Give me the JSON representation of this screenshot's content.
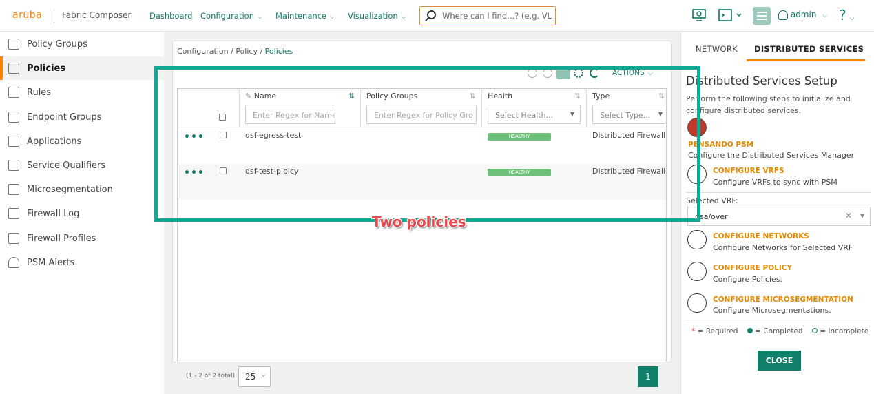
{
  "header": {
    "brand": "aruba",
    "app_name": "Fabric Composer",
    "nav": [
      "Dashboard",
      "Configuration",
      "Maintenance",
      "Visualization"
    ],
    "search_placeholder": "Where can I find...? (e.g. VL",
    "user": "admin",
    "help": "?"
  },
  "sidebar": {
    "items": [
      {
        "label": "Policy Groups",
        "icon": "policy-groups-icon"
      },
      {
        "label": "Policies",
        "icon": "policies-icon",
        "active": true
      },
      {
        "label": "Rules",
        "icon": "rules-icon"
      },
      {
        "label": "Endpoint Groups",
        "icon": "endpoint-groups-icon"
      },
      {
        "label": "Applications",
        "icon": "applications-icon"
      },
      {
        "label": "Service Qualifiers",
        "icon": "service-qualifiers-icon"
      },
      {
        "label": "Microsegmentation",
        "icon": "microsegmentation-icon"
      },
      {
        "label": "Firewall Log",
        "icon": "firewall-log-icon"
      },
      {
        "label": "Firewall Profiles",
        "icon": "firewall-profiles-icon"
      },
      {
        "label": "PSM Alerts",
        "icon": "bell-icon"
      }
    ]
  },
  "breadcrumb": {
    "part1": "Configuration",
    "sep": " / ",
    "part2": "Policy",
    "current": "Policies"
  },
  "toolbar": {
    "actions_label": "ACTIONS"
  },
  "table": {
    "columns": {
      "name": "Name",
      "policy_groups": "Policy Groups",
      "health": "Health",
      "type": "Type"
    },
    "filters": {
      "name": "Enter Regex for Name...",
      "policy_groups": "Enter Regex for Policy Gro",
      "health": "Select Health...",
      "type": "Select Type..."
    },
    "rows": [
      {
        "name": "dsf-egress-test",
        "health": "HEALTHY",
        "type": "Distributed Firewall"
      },
      {
        "name": "dsf-test-ploicy",
        "health": "HEALTHY",
        "type": "Distributed Firewall"
      }
    ],
    "row_menu": "•••"
  },
  "annotation": {
    "text": "Two policies",
    "color": "#11a894"
  },
  "pagination": {
    "summary": "(1 - 2 of 2 total)",
    "page_size": "25",
    "current_page": "1"
  },
  "right_panel": {
    "tabs": [
      "NETWORK",
      "DISTRIBUTED SERVICES"
    ],
    "title": "Distributed Services Setup",
    "description": "Perform the following steps to initialize and configure distributed services.",
    "steps": [
      {
        "title": "PENSANDO PSM",
        "desc": "Configure the Distributed Services Manager"
      },
      {
        "title": "CONFIGURE VRFS",
        "desc": "Configure VRFs to sync with PSM"
      },
      {
        "title": "CONFIGURE NETWORKS",
        "desc": "Configure Networks for Selected VRF"
      },
      {
        "title": "CONFIGURE POLICY",
        "desc": "Configure Policies."
      },
      {
        "title": "CONFIGURE MICROSEGMENTATION",
        "desc": "Configure Microsegmentations."
      }
    ],
    "vrf_label": "Selected VRF:",
    "vrf_value": "dsa/over",
    "legend": {
      "required": "= Required",
      "completed": "= Completed",
      "incomplete": "= Incomplete"
    },
    "close_label": "CLOSE"
  },
  "colors": {
    "accent": "#ff8300",
    "teal": "#0e7a65",
    "healthy": "#6dbf7a",
    "annotation_text": "#e84a50"
  }
}
